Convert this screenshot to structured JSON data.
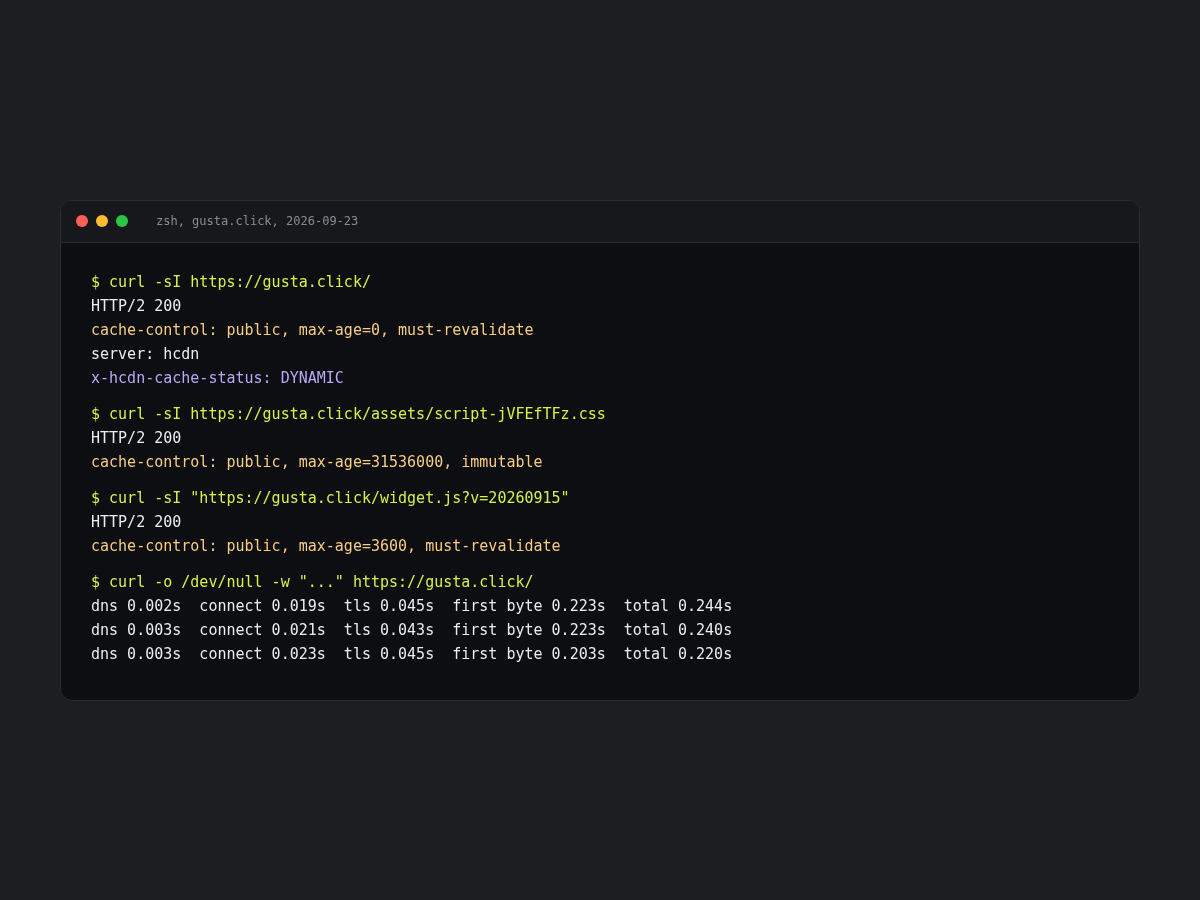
{
  "window": {
    "title": "zsh, gusta.click, 2026-09-23"
  },
  "blocks": [
    {
      "lines": [
        {
          "kind": "command",
          "text": "$ curl -sI https://gusta.click/"
        },
        {
          "kind": "output",
          "text": "HTTP/2 200"
        },
        {
          "kind": "header",
          "text": "cache-control: public, max-age=0, must-revalidate"
        },
        {
          "kind": "output",
          "text": "server: hcdn"
        },
        {
          "kind": "status",
          "text": "x-hcdn-cache-status: DYNAMIC"
        }
      ]
    },
    {
      "lines": [
        {
          "kind": "command",
          "text": "$ curl -sI https://gusta.click/assets/script-jVFEfTFz.css"
        },
        {
          "kind": "output",
          "text": "HTTP/2 200"
        },
        {
          "kind": "header",
          "text": "cache-control: public, max-age=31536000, immutable"
        }
      ]
    },
    {
      "lines": [
        {
          "kind": "command",
          "text": "$ curl -sI \"https://gusta.click/widget.js?v=20260915\""
        },
        {
          "kind": "output",
          "text": "HTTP/2 200"
        },
        {
          "kind": "header",
          "text": "cache-control: public, max-age=3600, must-revalidate"
        }
      ]
    },
    {
      "lines": [
        {
          "kind": "command",
          "text": "$ curl -o /dev/null -w \"...\" https://gusta.click/"
        },
        {
          "kind": "output",
          "text": "dns 0.002s  connect 0.019s  tls 0.045s  first byte 0.223s  total 0.244s"
        },
        {
          "kind": "output",
          "text": "dns 0.003s  connect 0.021s  tls 0.043s  first byte 0.223s  total 0.240s"
        },
        {
          "kind": "output",
          "text": "dns 0.003s  connect 0.023s  tls 0.045s  first byte 0.203s  total 0.220s"
        }
      ]
    }
  ]
}
